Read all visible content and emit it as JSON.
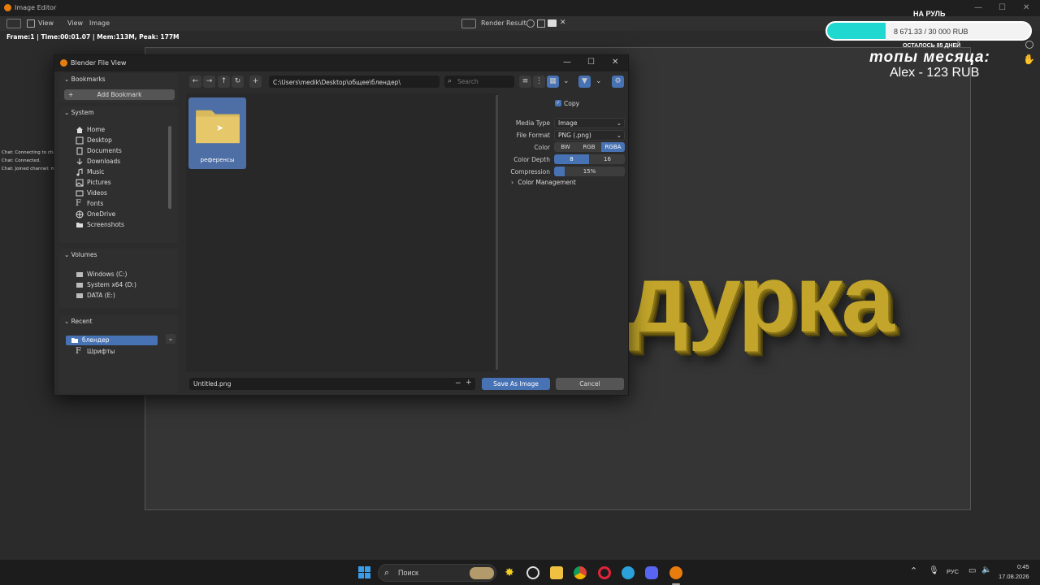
{
  "app": {
    "title": "Image Editor"
  },
  "menubar": {
    "view1": "View",
    "view2": "View",
    "image": "Image",
    "render_result": "Render Result"
  },
  "statusline": "Frame:1 | Time:00:01.07 | Mem:113M, Peak: 177M",
  "canvas_text": "дурка",
  "chat": [
    "Chat: Connecting to chat serv...",
    "Chat: Connected.",
    "Chat: Joined channel: medikst"
  ],
  "donation": {
    "label": "НА РУЛЬ",
    "amount_text": "8 671.33 / 30 000 RUB",
    "progress": 0.289,
    "remaining": "ОСТАЛОСЬ 85 ДНЕЙ",
    "fill_color": "#1fd9d0"
  },
  "top_month": {
    "title": "топы месяца:",
    "entry": "Alex - 123 RUB"
  },
  "dialog": {
    "title": "Blender File View",
    "bookmarks": {
      "heading": "Bookmarks",
      "add_label": "Add Bookmark"
    },
    "system": {
      "heading": "System",
      "items": [
        {
          "label": "Home",
          "icon": "home-icon"
        },
        {
          "label": "Desktop",
          "icon": "desktop-icon"
        },
        {
          "label": "Documents",
          "icon": "documents-icon"
        },
        {
          "label": "Downloads",
          "icon": "downloads-icon"
        },
        {
          "label": "Music",
          "icon": "music-icon"
        },
        {
          "label": "Pictures",
          "icon": "pictures-icon"
        },
        {
          "label": "Videos",
          "icon": "videos-icon"
        },
        {
          "label": "Fonts",
          "icon": "fonts-icon"
        },
        {
          "label": "OneDrive",
          "icon": "onedrive-icon"
        },
        {
          "label": "Screenshots",
          "icon": "folder-icon"
        }
      ]
    },
    "volumes": {
      "heading": "Volumes",
      "items": [
        {
          "label": "Windows (C:)"
        },
        {
          "label": "System x64 (D:)"
        },
        {
          "label": "DATA (E:)"
        }
      ]
    },
    "recent": {
      "heading": "Recent",
      "items": [
        {
          "label": "блендер",
          "selected": true
        },
        {
          "label": "Шрифты",
          "selected": false
        }
      ]
    },
    "path": "C:\\Users\\medik\\Desktop\\общее\\блендер\\",
    "search_placeholder": "Search",
    "files": [
      {
        "name": "референсы",
        "type": "folder"
      }
    ],
    "options": {
      "copy_label": "Copy",
      "copy_checked": true,
      "media_type_label": "Media Type",
      "media_type_value": "Image",
      "file_format_label": "File Format",
      "file_format_value": "PNG (.png)",
      "color_label": "Color",
      "color_options": [
        "BW",
        "RGB",
        "RGBA"
      ],
      "color_selected": "RGBA",
      "depth_label": "Color Depth",
      "depth_options": [
        "8",
        "16"
      ],
      "depth_selected": "8",
      "compression_label": "Compression",
      "compression_value": "15%",
      "compression_fraction": 0.15,
      "color_management_label": "Color Management"
    },
    "filename": "Untitled.png",
    "save_label": "Save As Image",
    "cancel_label": "Cancel",
    "accent": "#4772b3"
  },
  "taskbar": {
    "search_label": "Поиск",
    "lang": "РУС",
    "time": "0:45",
    "date": "17.08.2026"
  }
}
